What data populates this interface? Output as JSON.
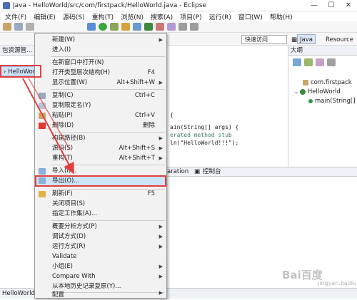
{
  "window": {
    "title": "Java - HelloWorld/src/com/firstpack/HelloWorld.java - Eclipse",
    "min": "—",
    "max": "☐",
    "close": "✕"
  },
  "menubar": [
    "文件(F)",
    "编辑(E)",
    "源码(S)",
    "重构(T)",
    "浏览(N)",
    "搜索(A)",
    "项目(P)",
    "运行(R)",
    "窗口(W)",
    "帮助(H)"
  ],
  "quick_access": "快速访问",
  "perspectives": {
    "java": "Java",
    "resource": "Resource"
  },
  "package_explorer": {
    "tab": "包资源管...",
    "project": "HelloWorld"
  },
  "editor": {
    "lines": [
      "{",
      "ain(String[] args) {",
      "erated method stub",
      "ln(\"HelloWorld!!!\");"
    ]
  },
  "bottom_tabs": {
    "separation": "aration",
    "console": "控制台"
  },
  "outline": {
    "tab": "大纲",
    "items": [
      "com.firstpack",
      "HelloWorld",
      "main(String[]"
    ]
  },
  "status_bar": "HelloWorld",
  "context_menu": {
    "items": [
      {
        "label": "新建(W)",
        "shortcut": "",
        "submenu": true
      },
      {
        "label": "进入(I)",
        "shortcut": "",
        "submenu": false
      },
      {
        "label": "在新窗口中打开(N)",
        "shortcut": "",
        "submenu": false
      },
      {
        "label": "打开类型层次结构(H)",
        "shortcut": "F4",
        "submenu": false
      },
      {
        "label": "显示位置(W)",
        "shortcut": "Alt+Shift+W",
        "submenu": true
      },
      {
        "label": "复制(C)",
        "shortcut": "Ctrl+C",
        "submenu": false
      },
      {
        "label": "复制限定名(Y)",
        "shortcut": "",
        "submenu": false
      },
      {
        "label": "粘贴(P)",
        "shortcut": "Ctrl+V",
        "submenu": false
      },
      {
        "label": "删除(D)",
        "shortcut": "删除",
        "submenu": false
      },
      {
        "label": "构建路径(B)",
        "shortcut": "",
        "submenu": true
      },
      {
        "label": "源码(S)",
        "shortcut": "Alt+Shift+S",
        "submenu": true
      },
      {
        "label": "重构(T)",
        "shortcut": "Alt+Shift+T",
        "submenu": true
      },
      {
        "label": "导入(I)...",
        "shortcut": "",
        "submenu": false
      },
      {
        "label": "导出(O)...",
        "shortcut": "",
        "submenu": false
      },
      {
        "label": "刷新(F)",
        "shortcut": "F5",
        "submenu": false
      },
      {
        "label": "关闭项目(S)",
        "shortcut": "",
        "submenu": false
      },
      {
        "label": "指定工作集(A)...",
        "shortcut": "",
        "submenu": false
      },
      {
        "label": "概要分析方式(P)",
        "shortcut": "",
        "submenu": true
      },
      {
        "label": "调试方式(D)",
        "shortcut": "",
        "submenu": true
      },
      {
        "label": "运行方式(R)",
        "shortcut": "",
        "submenu": true
      },
      {
        "label": "Validate",
        "shortcut": "",
        "submenu": false
      },
      {
        "label": "小组(E)",
        "shortcut": "",
        "submenu": true
      },
      {
        "label": "Compare With",
        "shortcut": "",
        "submenu": true
      },
      {
        "label": "从本地历史记录复原(Y)...",
        "shortcut": "",
        "submenu": false
      },
      {
        "label": "配置",
        "shortcut": "",
        "submenu": true
      }
    ]
  },
  "watermark": {
    "logo": "Bai百度",
    "sub": "jingyan.baidu.com"
  },
  "colors": {
    "highlight_border": "#e43f3f",
    "selection": "#cce4f7"
  }
}
